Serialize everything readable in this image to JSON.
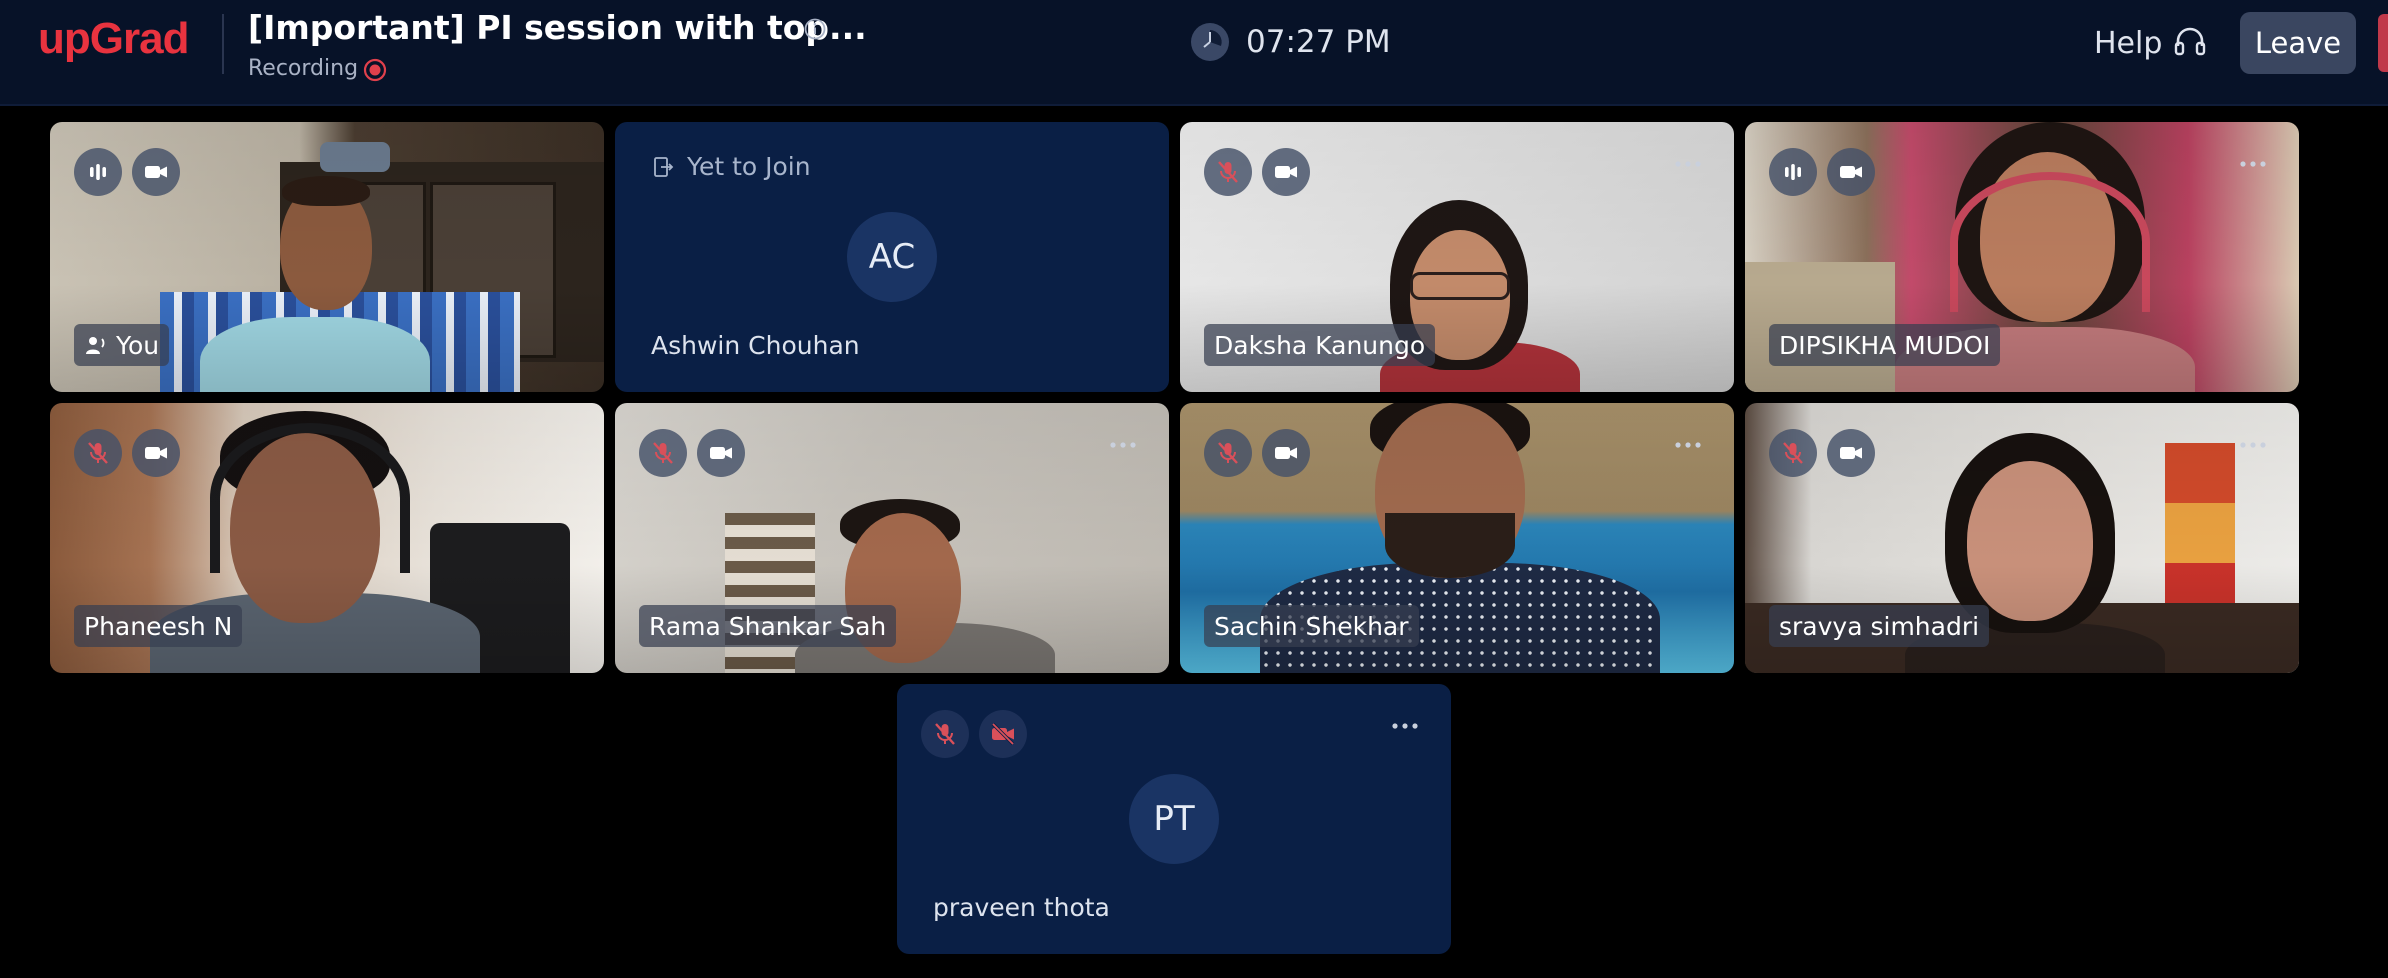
{
  "header": {
    "logo": "upGrad",
    "meeting_title": "[Important] PI session with top...",
    "recording_label": "Recording",
    "time": "07:27 PM",
    "help_label": "Help",
    "leave_label": "Leave"
  },
  "participants": [
    {
      "name": "You",
      "status": "video",
      "mic": "speaking",
      "camera": "on"
    },
    {
      "name": "Ashwin Chouhan",
      "status": "Yet to Join",
      "initials": "AC"
    },
    {
      "name": "Daksha Kanungo",
      "status": "video",
      "mic": "muted",
      "camera": "on"
    },
    {
      "name": "DIPSIKHA MUDOI",
      "status": "video",
      "mic": "speaking",
      "camera": "on"
    },
    {
      "name": "Phaneesh N",
      "status": "video",
      "mic": "muted",
      "camera": "on"
    },
    {
      "name": "Rama Shankar Sah",
      "status": "video",
      "mic": "muted",
      "camera": "on"
    },
    {
      "name": "Sachin Shekhar",
      "status": "video",
      "mic": "muted",
      "camera": "on"
    },
    {
      "name": "sravya simhadri",
      "status": "video",
      "mic": "muted",
      "camera": "on"
    },
    {
      "name": "praveen thota",
      "status": "audio",
      "mic": "muted",
      "camera": "off",
      "initials": "PT"
    }
  ],
  "colors": {
    "brand": "#e8333f",
    "topbar_bg": "#071228",
    "tile_bg": "#0a1f45",
    "muted_red": "#d9505a",
    "recording_red": "#e0404c"
  }
}
